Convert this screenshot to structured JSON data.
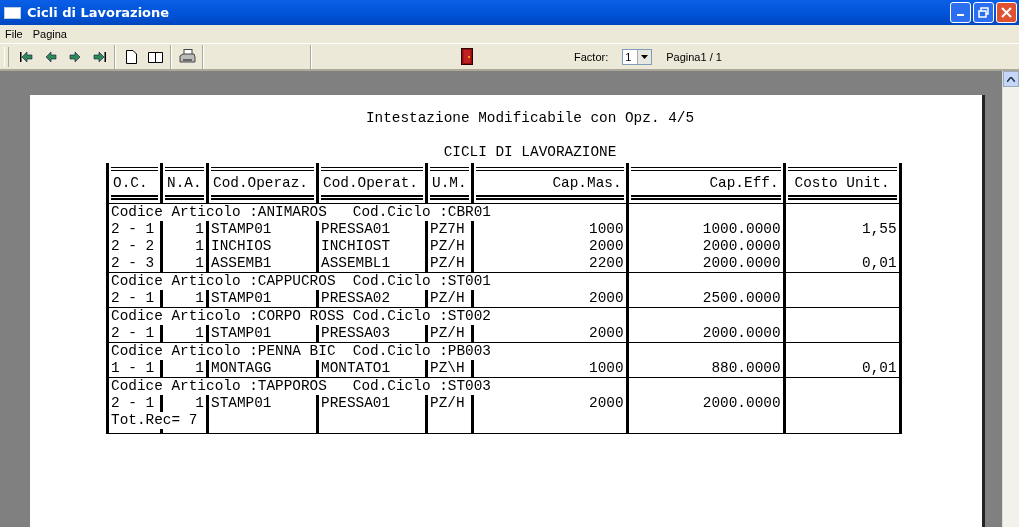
{
  "window": {
    "title": "Cicli di Lavorazione"
  },
  "menu": [
    "File",
    "Pagina"
  ],
  "toolbar": {
    "factor_label": "Factor:",
    "factor_value": "1",
    "page_label": "Pagina1 / 1"
  },
  "report": {
    "heading": "Intestazione Modificabile con Opz. 4/5",
    "title": "CICLI DI LAVORAZIONE",
    "columns": [
      "O.C.",
      "N.A.",
      "Cod.Operaz.",
      "Cod.Operat.",
      "U.M.",
      "Cap.Mas.",
      "Cap.Eff.",
      "Costo Unit."
    ],
    "groups": [
      {
        "header": "Codice Articolo :ANIMAROS   Cod.Ciclo :CBR01",
        "rows": [
          {
            "oc": "2 - 1",
            "na": "1",
            "cod_operaz": "STAMP01",
            "cod_operat": "PRESSA01",
            "um": "PZ7H",
            "cap_mas": "1000",
            "cap_eff": "1000.0000",
            "costo_unit": "1,55"
          },
          {
            "oc": "2 - 2",
            "na": "1",
            "cod_operaz": "INCHIOS",
            "cod_operat": "INCHIOST",
            "um": "PZ/H",
            "cap_mas": "2000",
            "cap_eff": "2000.0000"
          },
          {
            "oc": "2 - 3",
            "na": "1",
            "cod_operaz": "ASSEMB1",
            "cod_operat": "ASSEMBL1",
            "um": "PZ/H",
            "cap_mas": "2200",
            "cap_eff": "2000.0000",
            "costo_unit": "0,01"
          }
        ]
      },
      {
        "header": "Codice Articolo :CAPPUCROS  Cod.Ciclo :ST001",
        "rows": [
          {
            "oc": "2 - 1",
            "na": "1",
            "cod_operaz": "STAMP01",
            "cod_operat": "PRESSA02",
            "um": "PZ/H",
            "cap_mas": "2000",
            "cap_eff": "2500.0000"
          }
        ]
      },
      {
        "header": "Codice Articolo :CORPO ROSS Cod.Ciclo :ST002",
        "rows": [
          {
            "oc": "2 - 1",
            "na": "1",
            "cod_operaz": "STAMP01",
            "cod_operat": "PRESSA03",
            "um": "PZ/H",
            "cap_mas": "2000",
            "cap_eff": "2000.0000"
          }
        ]
      },
      {
        "header": "Codice Articolo :PENNA BIC  Cod.Ciclo :PB003",
        "rows": [
          {
            "oc": "1 - 1",
            "na": "1",
            "cod_operaz": "MONTAGG",
            "cod_operat": "MONTATO1",
            "um": "PZ\\H",
            "cap_mas": "1000",
            "cap_eff": "880.0000",
            "costo_unit": "0,01"
          }
        ]
      },
      {
        "header": "Codice Articolo :TAPPOROS   Cod.Ciclo :ST003",
        "rows": [
          {
            "oc": "2 - 1",
            "na": "1",
            "cod_operaz": "STAMP01",
            "cod_operat": "PRESSA01",
            "um": "PZ/H",
            "cap_mas": "2000",
            "cap_eff": "2000.0000"
          }
        ]
      }
    ],
    "total": "Tot.Rec= 7"
  }
}
